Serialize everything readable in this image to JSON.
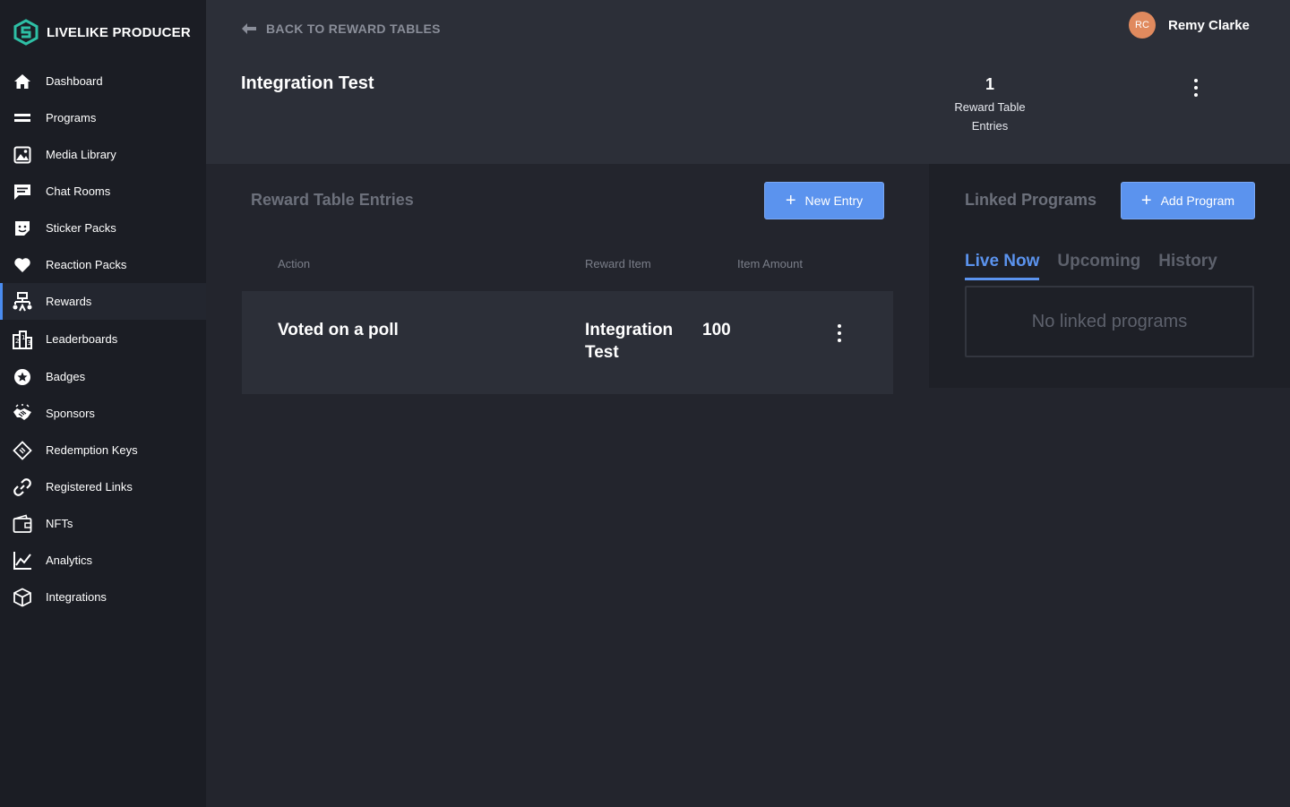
{
  "brand": {
    "name": "LIVELIKE PRODUCER",
    "accent": "#2ebfa5"
  },
  "nav": {
    "items": [
      {
        "label": "Dashboard",
        "icon": "home-icon"
      },
      {
        "label": "Programs",
        "icon": "programs-icon"
      },
      {
        "label": "Media Library",
        "icon": "image-icon"
      },
      {
        "label": "Chat Rooms",
        "icon": "chat-icon"
      },
      {
        "label": "Sticker Packs",
        "icon": "sticker-icon"
      },
      {
        "label": "Reaction Packs",
        "icon": "heart-icon"
      },
      {
        "label": "Rewards",
        "icon": "rewards-icon",
        "active": true
      },
      {
        "label": "Leaderboards",
        "icon": "leaderboard-icon"
      },
      {
        "label": "Badges",
        "icon": "badge-icon"
      },
      {
        "label": "Sponsors",
        "icon": "handshake-icon"
      },
      {
        "label": "Redemption Keys",
        "icon": "ticket-icon"
      },
      {
        "label": "Registered Links",
        "icon": "link-icon"
      },
      {
        "label": "NFTs",
        "icon": "wallet-icon"
      },
      {
        "label": "Analytics",
        "icon": "analytics-icon"
      },
      {
        "label": "Integrations",
        "icon": "cube-icon"
      }
    ]
  },
  "header": {
    "back_label": "BACK TO REWARD TABLES",
    "title": "Integration Test",
    "stat_value": "1",
    "stat_label_line1": "Reward Table",
    "stat_label_line2": "Entries"
  },
  "user": {
    "initials": "RC",
    "name": "Remy Clarke",
    "avatar_color": "#e08a5e"
  },
  "entries": {
    "title": "Reward Table Entries",
    "new_button": "New Entry",
    "columns": [
      "Action",
      "Reward Item",
      "Item Amount"
    ],
    "rows": [
      {
        "action": "Voted on a poll",
        "reward_item_line1": "Integration",
        "reward_item_line2": "Test",
        "amount": "100"
      }
    ]
  },
  "linked": {
    "title": "Linked Programs",
    "add_button": "Add Program",
    "tabs": [
      "Live Now",
      "Upcoming",
      "History"
    ],
    "active_tab": "Live Now",
    "empty_text": "No linked programs"
  },
  "colors": {
    "primary": "#5b93ee",
    "sidebar_bg": "#1b1d24",
    "header_bg": "#2c2f38"
  }
}
